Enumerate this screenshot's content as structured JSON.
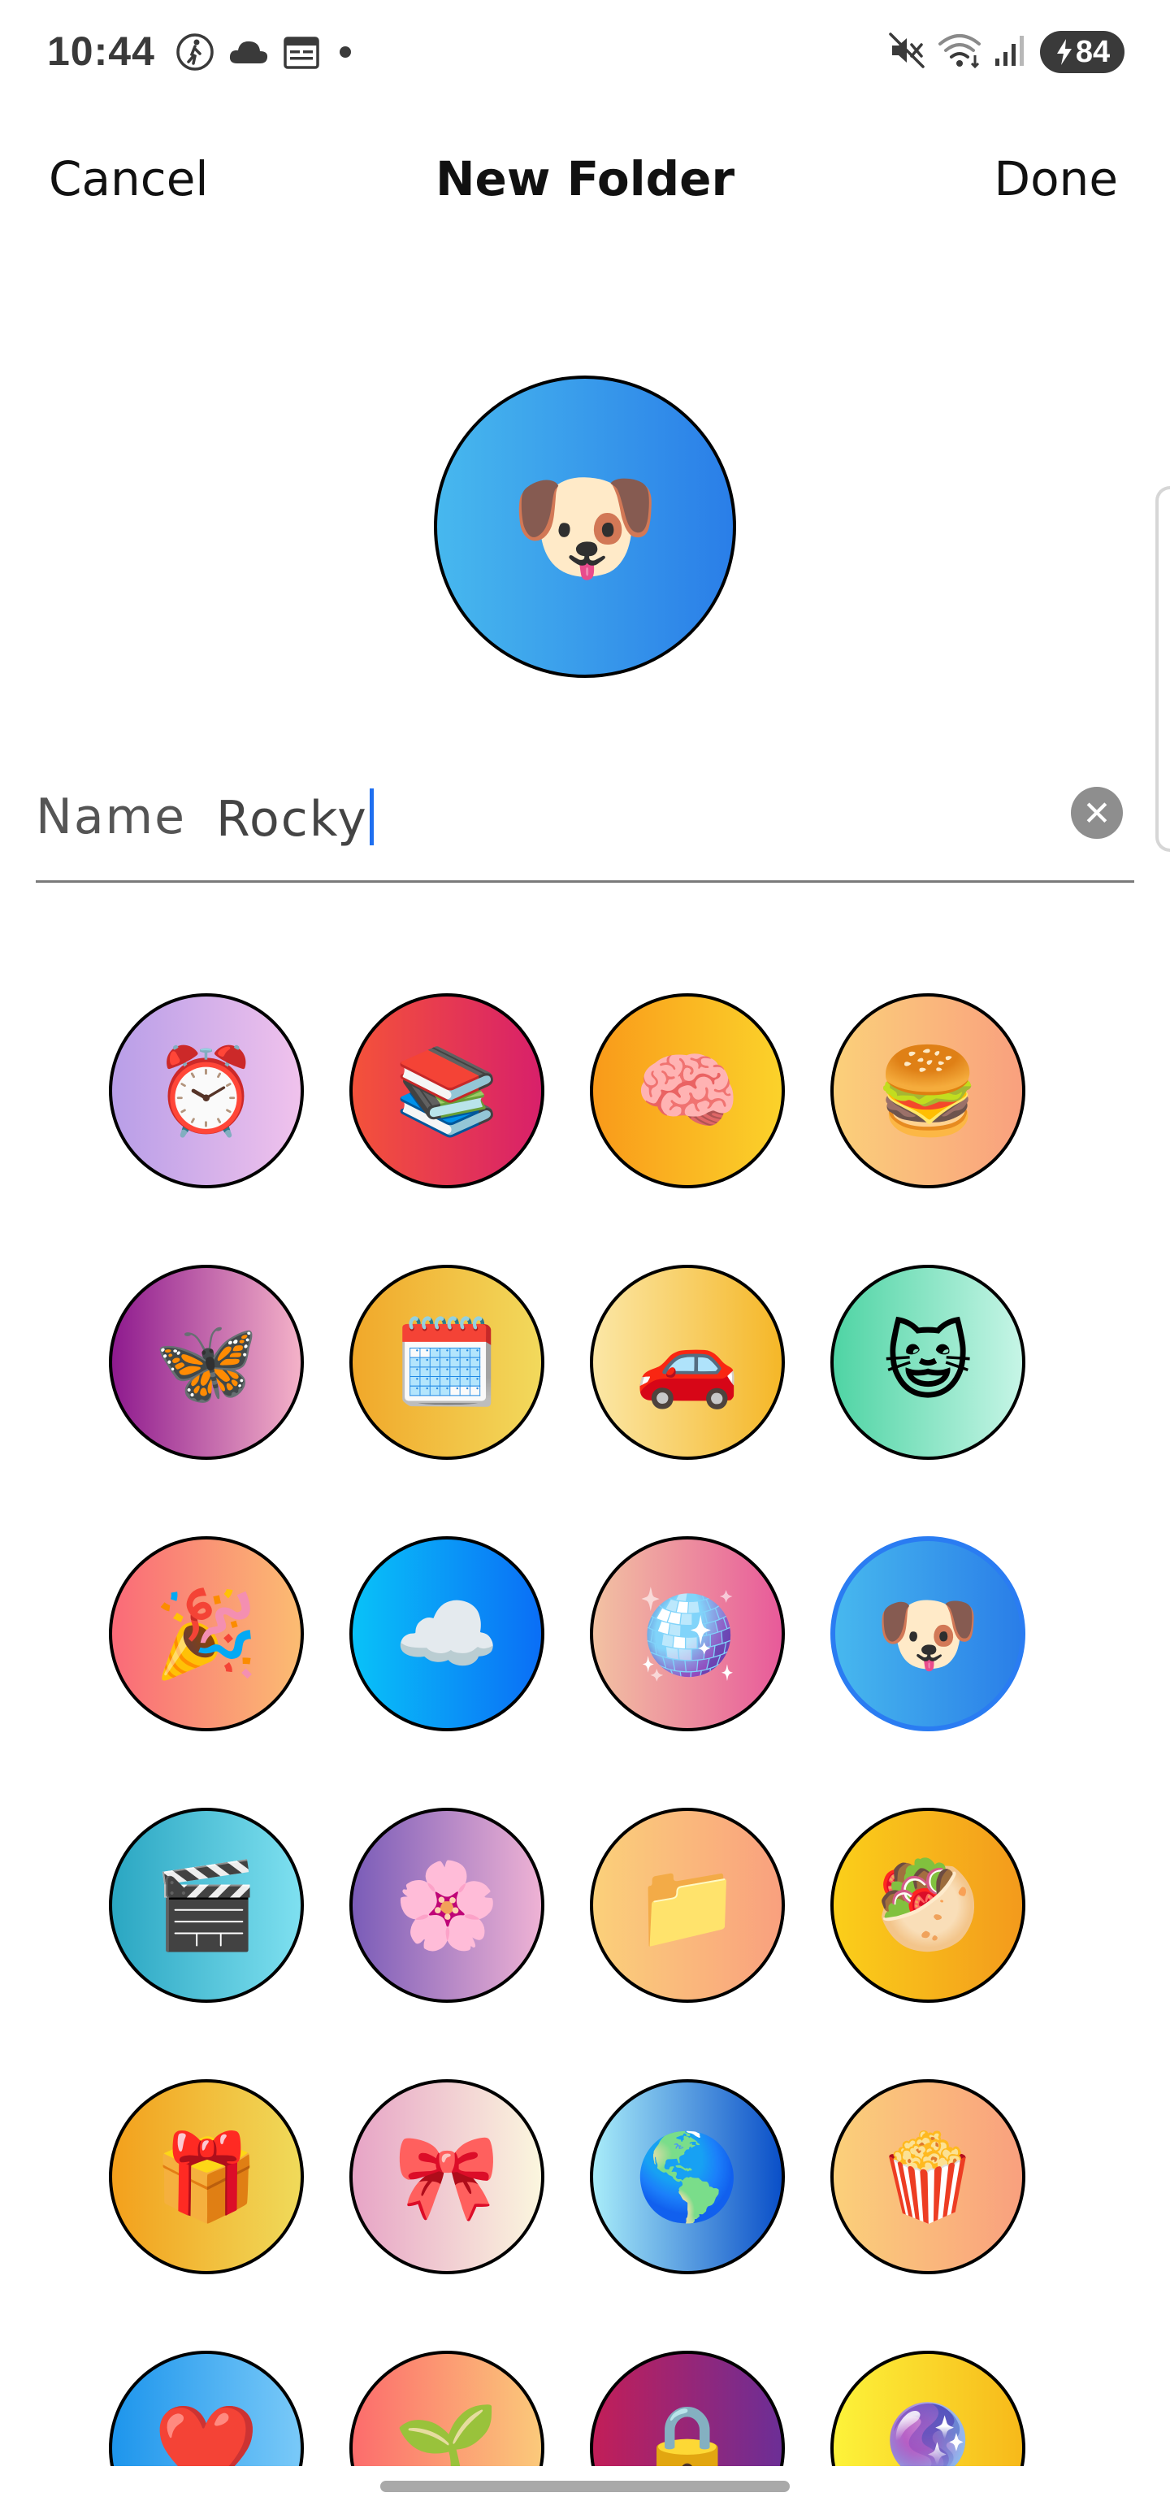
{
  "status_bar": {
    "time": "10:44",
    "left_icons": [
      "walk-icon",
      "cloud-icon",
      "calendar-icon",
      "dot-icon"
    ],
    "right_icons": [
      "mute-icon",
      "wifi-icon",
      "signal-icon"
    ],
    "battery_level": "84"
  },
  "nav": {
    "cancel_label": "Cancel",
    "title": "New Folder",
    "done_label": "Done"
  },
  "preview": {
    "emoji": "🐶",
    "gradient": [
      "#47b8ee",
      "#2a7ee8"
    ]
  },
  "name_field": {
    "label": "Name",
    "value": "Rocky",
    "clear_icon": "close-icon"
  },
  "icon_options": [
    {
      "emoji": "⏰",
      "name": "alarm-clock-icon",
      "colors": [
        "#b89ee8",
        "#f0c2ec"
      ]
    },
    {
      "emoji": "📚",
      "name": "books-icon",
      "colors": [
        "#f4523a",
        "#d8206a"
      ]
    },
    {
      "emoji": "🧠",
      "name": "brain-icon",
      "colors": [
        "#f99a1a",
        "#fbd22a"
      ]
    },
    {
      "emoji": "🍔",
      "name": "burger-icon",
      "colors": [
        "#fbd07a",
        "#f9a07e"
      ]
    },
    {
      "emoji": "🦋",
      "name": "butterfly-icon",
      "colors": [
        "#8e1a8e",
        "#f4b2c8"
      ]
    },
    {
      "emoji": "🗓️",
      "name": "calendar-icon",
      "colors": [
        "#f1a82a",
        "#f2d95c"
      ]
    },
    {
      "emoji": "🚗",
      "name": "car-icon",
      "colors": [
        "#fbe7a6",
        "#f5b728"
      ]
    },
    {
      "emoji": "😺",
      "name": "cat-icon",
      "colors": [
        "#4fd4a4",
        "#c6f5e6"
      ]
    },
    {
      "emoji": "🎉",
      "name": "party-icon",
      "colors": [
        "#fa6a78",
        "#fbbc72"
      ]
    },
    {
      "emoji": "☁️",
      "name": "cloud-icon",
      "colors": [
        "#09c2f8",
        "#0a6ef6"
      ]
    },
    {
      "emoji": "🪩",
      "name": "disco-ball-icon",
      "colors": [
        "#f2c2a2",
        "#e85a9a"
      ]
    },
    {
      "emoji": "🐶",
      "name": "dog-icon",
      "colors": [
        "#47b8ee",
        "#2a7ee8"
      ],
      "selected": true
    },
    {
      "emoji": "🎬",
      "name": "clapper-board-icon",
      "colors": [
        "#2aa6c2",
        "#7ee0f0"
      ]
    },
    {
      "emoji": "🌸",
      "name": "cherry-blossom-icon",
      "colors": [
        "#7a5cb8",
        "#eeb2d4"
      ]
    },
    {
      "emoji": "📁",
      "name": "folder-icon",
      "colors": [
        "#fbd07a",
        "#f9a07e"
      ]
    },
    {
      "emoji": "🥙",
      "name": "stuffed-flatbread-icon",
      "colors": [
        "#fbcf1a",
        "#f39a1c"
      ]
    },
    {
      "emoji": "🎁",
      "name": "gift-icon",
      "colors": [
        "#f3a01c",
        "#f0da5a"
      ]
    },
    {
      "emoji": "🎀",
      "name": "ribbon-icon",
      "colors": [
        "#e7a4c6",
        "#fbf6de"
      ]
    },
    {
      "emoji": "🌎",
      "name": "globe-icon",
      "colors": [
        "#a8ecf9",
        "#0a4fc8"
      ]
    },
    {
      "emoji": "🍿",
      "name": "popcorn-icon",
      "colors": [
        "#fbd07a",
        "#f9a07e"
      ]
    },
    {
      "emoji": "❤️",
      "name": "heart-icon",
      "colors": [
        "#1d95ec",
        "#79c9f8"
      ]
    },
    {
      "emoji": "🌱",
      "name": "seedling-icon",
      "colors": [
        "#fc6c6c",
        "#fbc97a"
      ]
    },
    {
      "emoji": "🔒",
      "name": "lock-icon",
      "colors": [
        "#c21e58",
        "#6c2e96"
      ]
    },
    {
      "emoji": "🔮",
      "name": "crystal-ball-icon",
      "colors": [
        "#fdf33a",
        "#f7b91a"
      ]
    }
  ]
}
